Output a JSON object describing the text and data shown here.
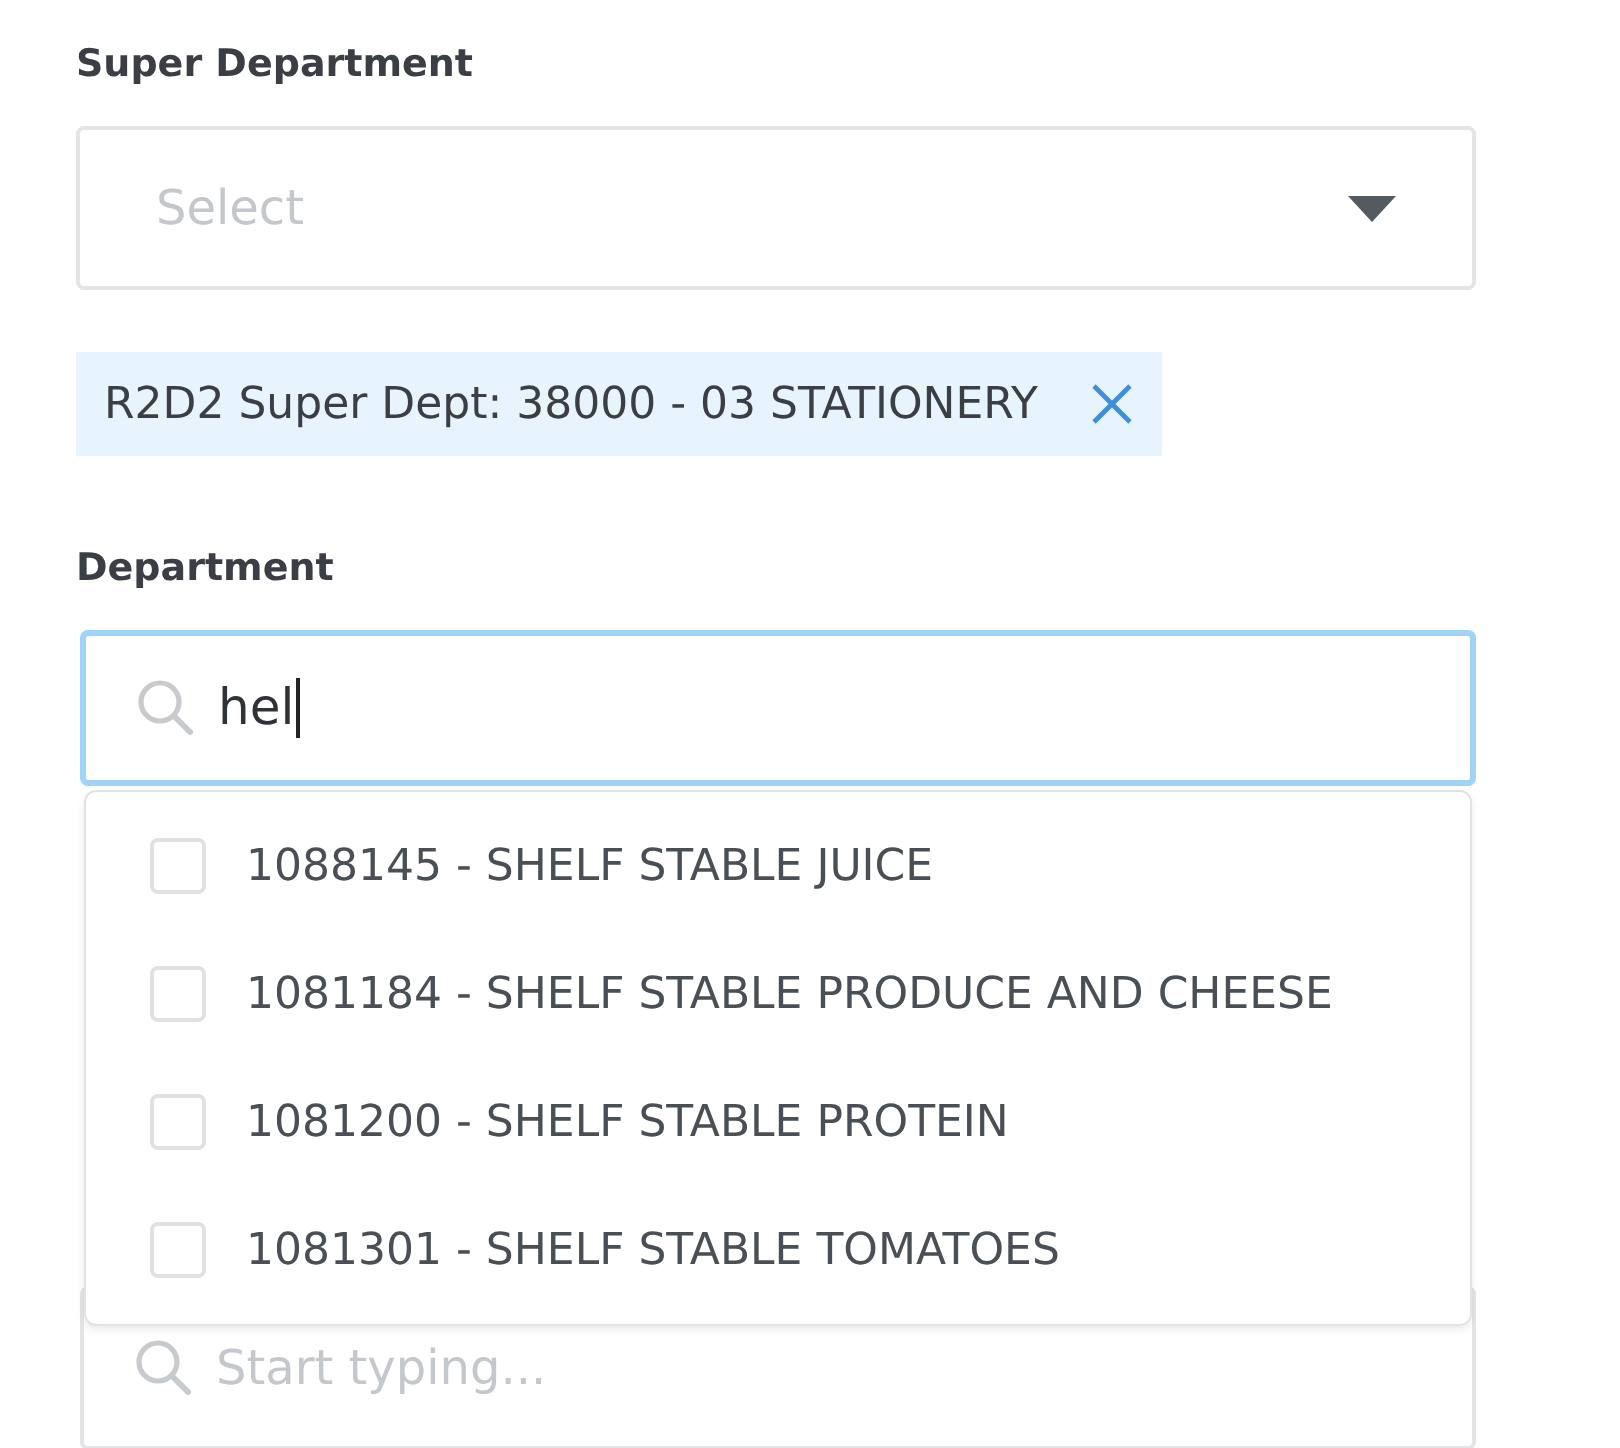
{
  "super_department": {
    "label": "Super Department",
    "placeholder": "Select",
    "tags": [
      {
        "text": "R2D2 Super Dept: 38000 - 03 STATIONERY"
      }
    ]
  },
  "department": {
    "label": "Department",
    "value": "hel",
    "options": [
      {
        "label": "1088145 - SHELF STABLE JUICE",
        "checked": false
      },
      {
        "label": "1081184 - SHELF STABLE PRODUCE AND CHEESE",
        "checked": false
      },
      {
        "label": "1081200 - SHELF STABLE PROTEIN",
        "checked": false
      },
      {
        "label": "1081301 - SHELF STABLE TOMATOES",
        "checked": false
      }
    ]
  },
  "lower_field": {
    "placeholder": "Start typing..."
  }
}
